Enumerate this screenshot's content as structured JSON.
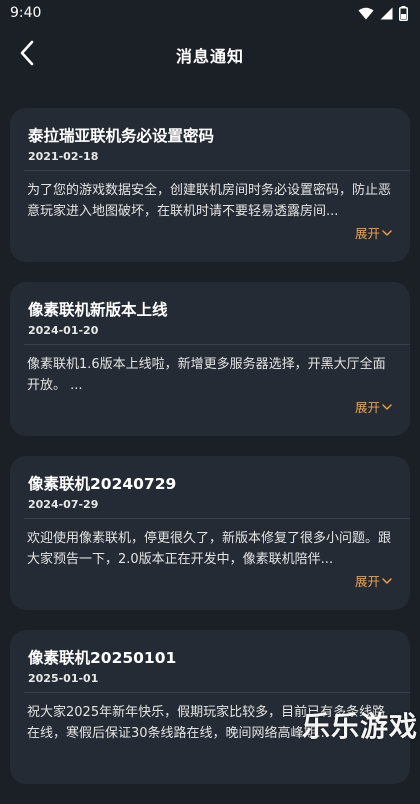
{
  "status_bar": {
    "time": "9:40",
    "icons": [
      "wifi-icon",
      "signal-icon",
      "battery-icon"
    ]
  },
  "header": {
    "title": "消息通知",
    "back_icon": "chevron-left-icon"
  },
  "expand_label": "展开",
  "notifications": [
    {
      "title": "泰拉瑞亚联机务必设置密码",
      "date": "2021-02-18",
      "body": "为了您的游戏数据安全，创建联机房间时务必设置密码，防止恶意玩家进入地图破坏，在联机时请不要轻易透露房间..."
    },
    {
      "title": "像素联机新版本上线",
      "date": "2024-01-20",
      "body": "像素联机1.6版本上线啦，新增更多服务器选择，开黑大厅全面开放。 ..."
    },
    {
      "title": "像素联机20240729",
      "date": "2024-07-29",
      "body": "欢迎使用像素联机，停更很久了，新版本修复了很多小问题。跟大家预告一下，2.0版本正在开发中，像素联机陪伴..."
    },
    {
      "title": "像素联机20250101",
      "date": "2025-01-01",
      "body": "祝大家2025年新年快乐，假期玩家比较多，目前已有多条线路在线，寒假后保证30条线路在线，晚间网络高峰期..."
    }
  ],
  "watermark": "乐乐游戏",
  "colors": {
    "background": "#1b1f26",
    "card": "#252b34",
    "accent": "#f0a046"
  }
}
